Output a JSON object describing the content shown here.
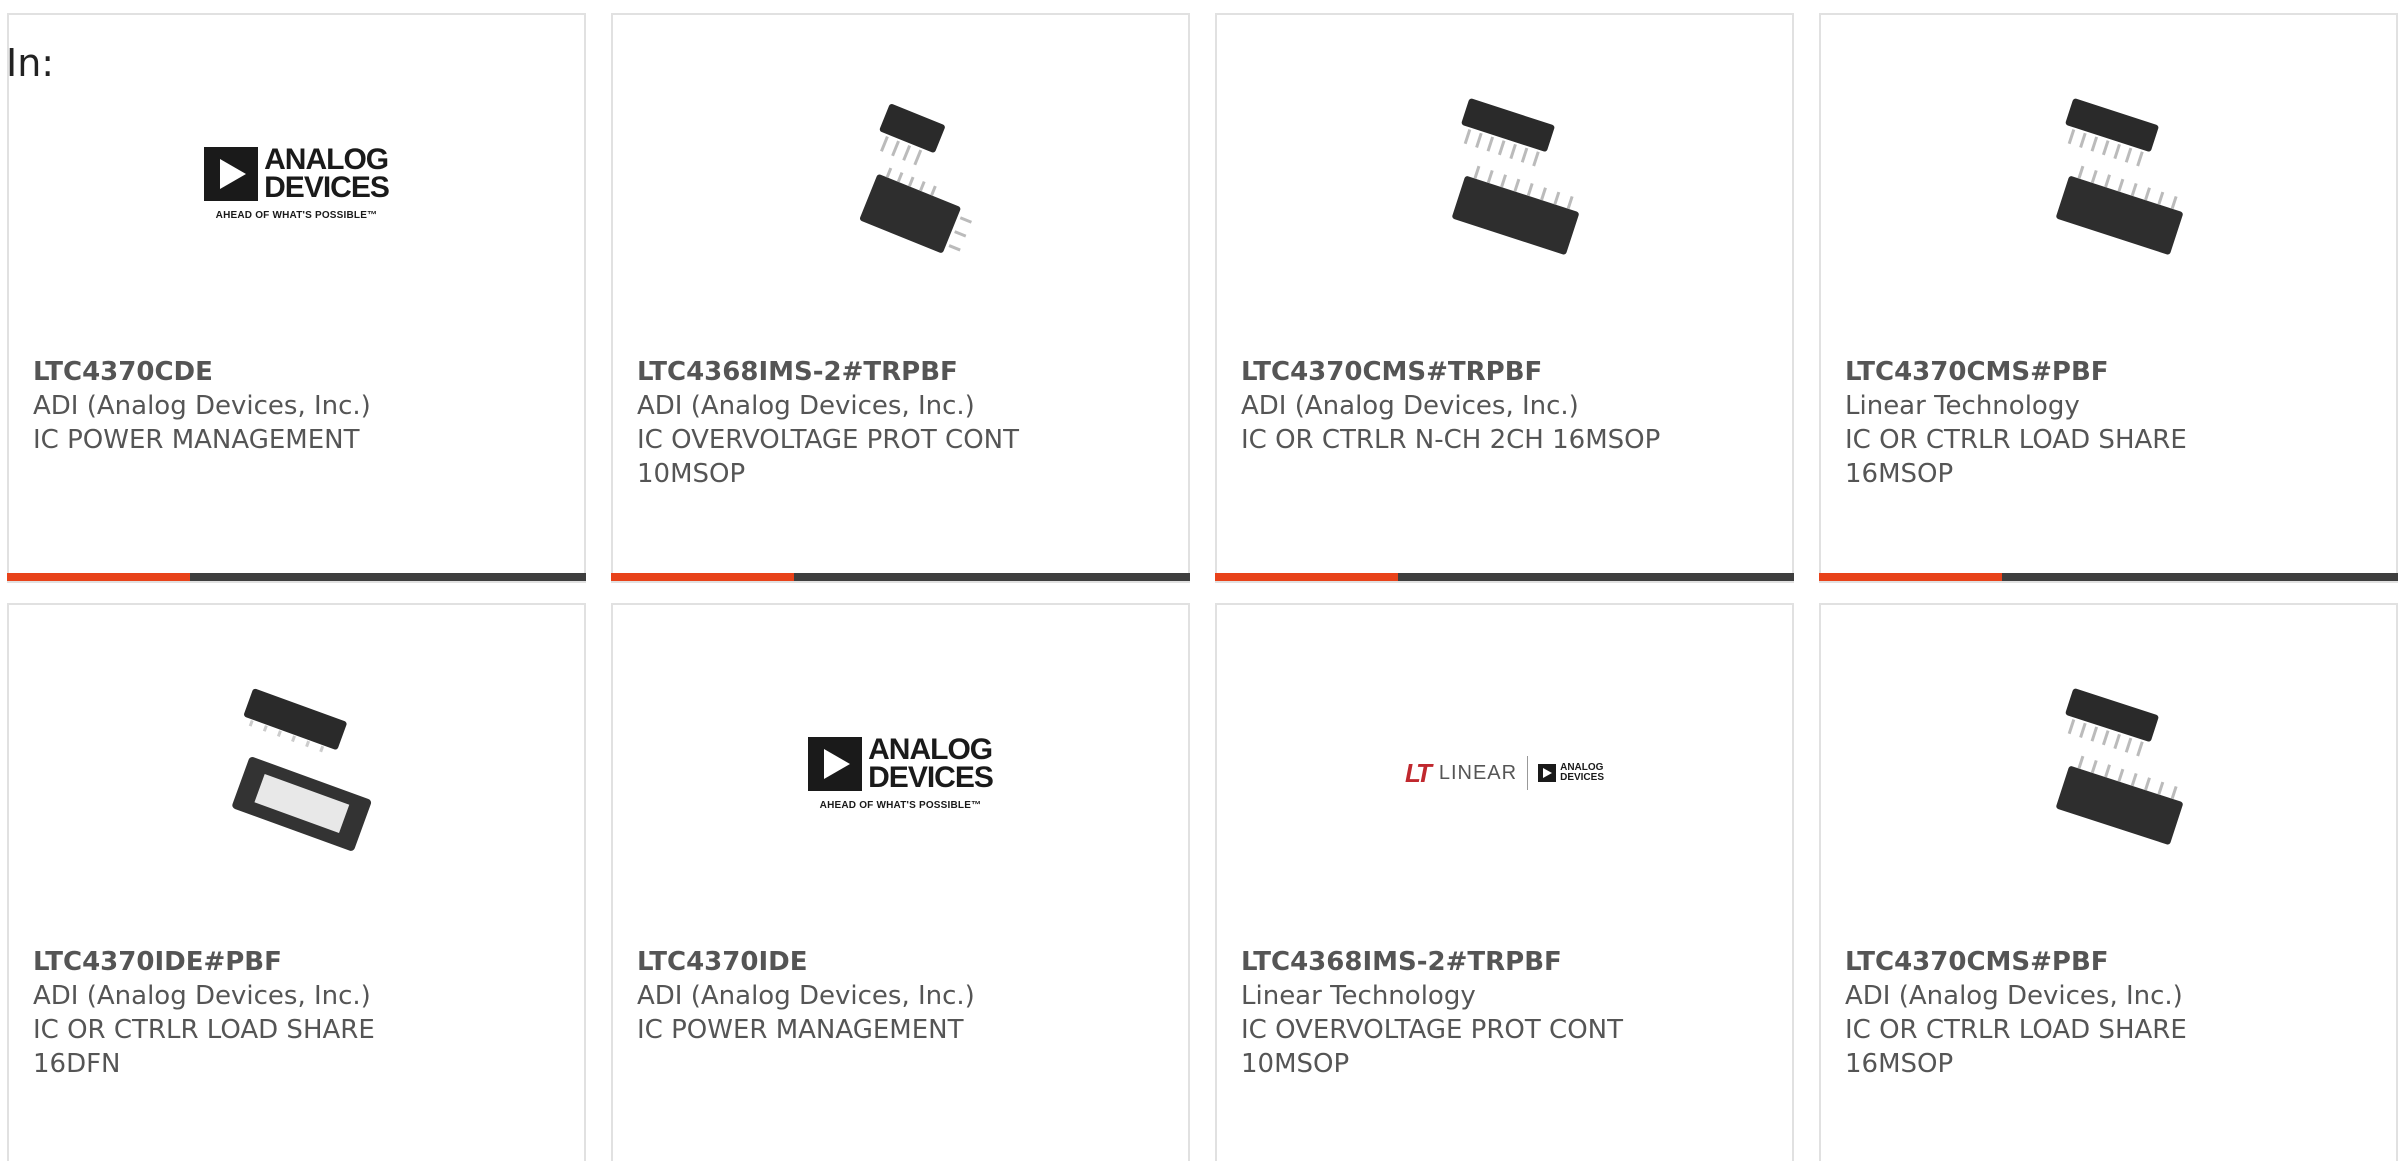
{
  "heading": "In:",
  "colors": {
    "accent": "#e8421a",
    "bar": "#3e3e3e",
    "text": "#555555"
  },
  "logos": {
    "analog_devices": {
      "line1": "ANALOG",
      "line2": "DEVICES",
      "tagline": "AHEAD OF WHAT'S POSSIBLE™"
    },
    "linear": {
      "mark": "LT",
      "word": "LINEAR",
      "adi_line1": "ANALOG",
      "adi_line2": "DEVICES"
    }
  },
  "products": [
    {
      "part": "LTC4370CDE",
      "manufacturer": "ADI (Analog Devices, Inc.)",
      "description": "IC POWER MANAGEMENT",
      "image": "analog-devices-logo"
    },
    {
      "part": "LTC4368IMS-2#TRPBF",
      "manufacturer": "ADI (Analog Devices, Inc.)",
      "description": "IC OVERVOLTAGE PROT CONT 10MSOP",
      "image": "msop-chip"
    },
    {
      "part": "LTC4370CMS#TRPBF",
      "manufacturer": "ADI (Analog Devices, Inc.)",
      "description": "IC OR CTRLR N-CH 2CH 16MSOP",
      "image": "msop-chip"
    },
    {
      "part": "LTC4370CMS#PBF",
      "manufacturer": "Linear Technology",
      "description": "IC OR CTRLR LOAD SHARE 16MSOP",
      "image": "msop-chip"
    },
    {
      "part": "LTC4370IDE#PBF",
      "manufacturer": "ADI (Analog Devices, Inc.)",
      "description": "IC OR CTRLR LOAD SHARE 16DFN",
      "image": "dfn-chip"
    },
    {
      "part": "LTC4370IDE",
      "manufacturer": "ADI (Analog Devices, Inc.)",
      "description": "IC POWER MANAGEMENT",
      "image": "analog-devices-logo"
    },
    {
      "part": "LTC4368IMS-2#TRPBF",
      "manufacturer": "Linear Technology",
      "description": "IC OVERVOLTAGE PROT CONT 10MSOP",
      "image": "linear-technology-logo"
    },
    {
      "part": "LTC4370CMS#PBF",
      "manufacturer": "ADI (Analog Devices, Inc.)",
      "description": "IC OR CTRLR LOAD SHARE 16MSOP",
      "image": "msop-chip"
    }
  ]
}
